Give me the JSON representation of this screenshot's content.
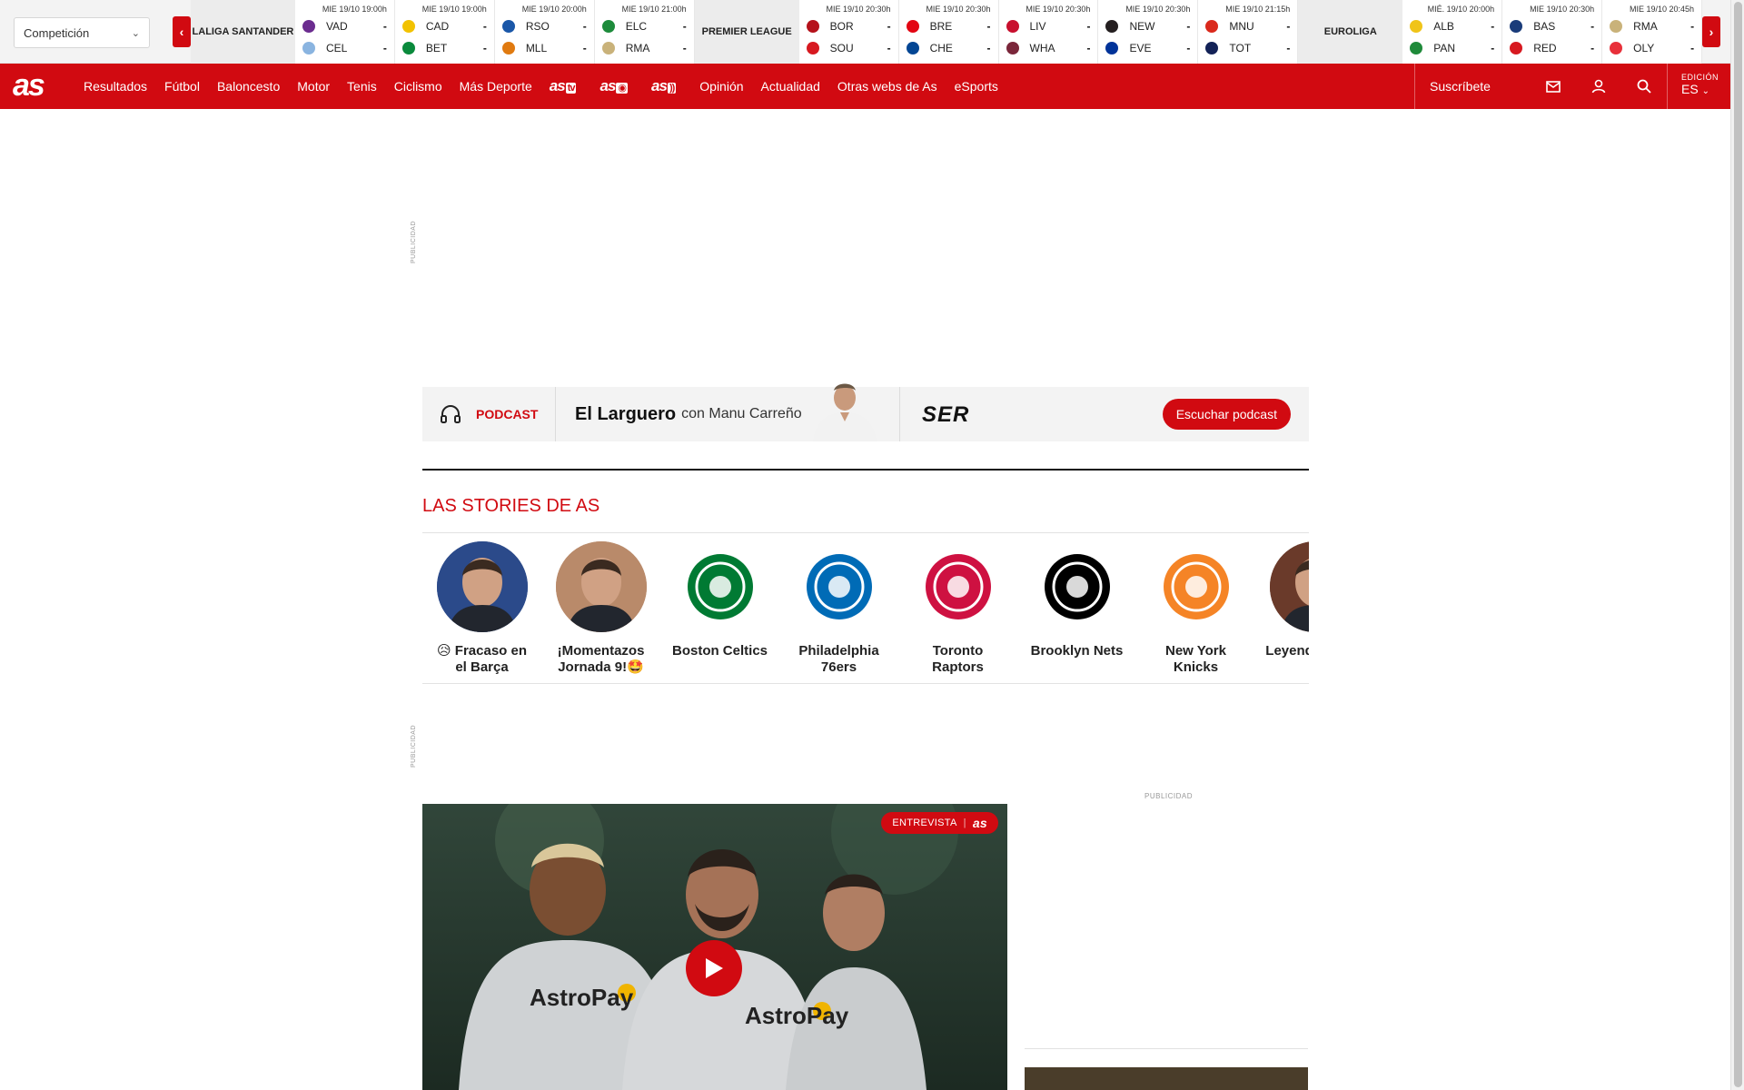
{
  "scoreboard": {
    "competition_select": "Competición",
    "leagues": [
      {
        "name": "LALIGA SANTANDER",
        "matches": [
          {
            "time": "MIE 19/10 19:00h",
            "home": "VAD",
            "away": "CEL",
            "home_score": "-",
            "away_score": "-",
            "home_color": "#6b2c8f",
            "away_color": "#8ab4e0"
          },
          {
            "time": "MIE 19/10 19:00h",
            "home": "CAD",
            "away": "BET",
            "home_score": "-",
            "away_score": "-",
            "home_color": "#f2c200",
            "away_color": "#0a8a3c"
          },
          {
            "time": "MIE 19/10 20:00h",
            "home": "RSO",
            "away": "MLL",
            "home_score": "-",
            "away_score": "-",
            "home_color": "#1a57a8",
            "away_color": "#e07a10"
          },
          {
            "time": "MIE 19/10 21:00h",
            "home": "ELC",
            "away": "RMA",
            "home_score": "-",
            "away_score": "-",
            "home_color": "#1d8b3b",
            "away_color": "#c9b27a"
          }
        ]
      },
      {
        "name": "PREMIER LEAGUE",
        "matches": [
          {
            "time": "MIE 19/10 20:30h",
            "home": "BOR",
            "away": "SOU",
            "home_score": "-",
            "away_score": "-",
            "home_color": "#b5121b",
            "away_color": "#d71920"
          },
          {
            "time": "MIE 19/10 20:30h",
            "home": "BRE",
            "away": "CHE",
            "home_score": "-",
            "away_score": "-",
            "home_color": "#e30613",
            "away_color": "#034694"
          },
          {
            "time": "MIE 19/10 20:30h",
            "home": "LIV",
            "away": "WHA",
            "home_score": "-",
            "away_score": "-",
            "home_color": "#c8102e",
            "away_color": "#7a263a"
          },
          {
            "time": "MIE 19/10 20:30h",
            "home": "NEW",
            "away": "EVE",
            "home_score": "-",
            "away_score": "-",
            "home_color": "#241f20",
            "away_color": "#003399"
          },
          {
            "time": "MIE 19/10 21:15h",
            "home": "MNU",
            "away": "TOT",
            "home_score": "-",
            "away_score": "-",
            "home_color": "#da291c",
            "away_color": "#132257"
          }
        ]
      },
      {
        "name": "EUROLIGA",
        "matches": [
          {
            "time": "MIÉ. 19/10 20:00h",
            "home": "ALB",
            "away": "PAN",
            "home_score": "-",
            "away_score": "-",
            "home_color": "#f0c419",
            "away_color": "#1f8a3a"
          },
          {
            "time": "MIE 19/10 20:30h",
            "home": "BAS",
            "away": "RED",
            "home_score": "-",
            "away_score": "-",
            "home_color": "#1a3c7a",
            "away_color": "#d71920"
          },
          {
            "time": "MIE 19/10 20:45h",
            "home": "RMA",
            "away": "OLY",
            "home_score": "-",
            "away_score": "-",
            "home_color": "#c9b27a",
            "away_color": "#e8303a"
          }
        ]
      }
    ]
  },
  "nav": {
    "logo": "as",
    "links_a": [
      "Resultados",
      "Fútbol",
      "Baloncesto",
      "Motor",
      "Tenis",
      "Ciclismo",
      "Más Deporte"
    ],
    "brand_links": [
      {
        "text": "as",
        "tag": "tv"
      },
      {
        "text": "as",
        "tag": "◉"
      },
      {
        "text": "as",
        "tag": "))"
      }
    ],
    "links_b": [
      "Opinión",
      "Actualidad",
      "Otras webs de As",
      "eSports"
    ],
    "subscribe": "Suscríbete",
    "edition_label": "EDICIÓN",
    "edition_value": "ES"
  },
  "ads": {
    "label": "PUBLICIDAD"
  },
  "podcast": {
    "tag": "PODCAST",
    "title": "El Larguero",
    "subtitle": "con Manu Carreño",
    "network": "SER",
    "cta": "Escuchar podcast"
  },
  "stories": {
    "title": "LAS STORIES DE AS",
    "items": [
      {
        "caption": "😥 Fracaso en el Barça",
        "kind": "photo",
        "color": "#2b4a8a"
      },
      {
        "caption": "¡Momentazos Jornada 9!🤩",
        "kind": "photo",
        "color": "#b98a6a"
      },
      {
        "caption": "Boston Celtics",
        "kind": "logo",
        "color": "#007a33"
      },
      {
        "caption": "Philadelphia 76ers",
        "kind": "logo",
        "color": "#006bb6"
      },
      {
        "caption": "Toronto Raptors",
        "kind": "logo",
        "color": "#ce1141"
      },
      {
        "caption": "Brooklyn Nets",
        "kind": "logo",
        "color": "#000000"
      },
      {
        "caption": "New York Knicks",
        "kind": "logo",
        "color": "#f58426"
      },
      {
        "caption": "Leyendas mate",
        "kind": "photo",
        "color": "#6a3a2a"
      }
    ]
  },
  "lead": {
    "badge": "ENTREVISTA",
    "badge_brand": "as",
    "sponsor_text": "AstroPay"
  },
  "colors": {
    "brand": "#d10a11"
  }
}
